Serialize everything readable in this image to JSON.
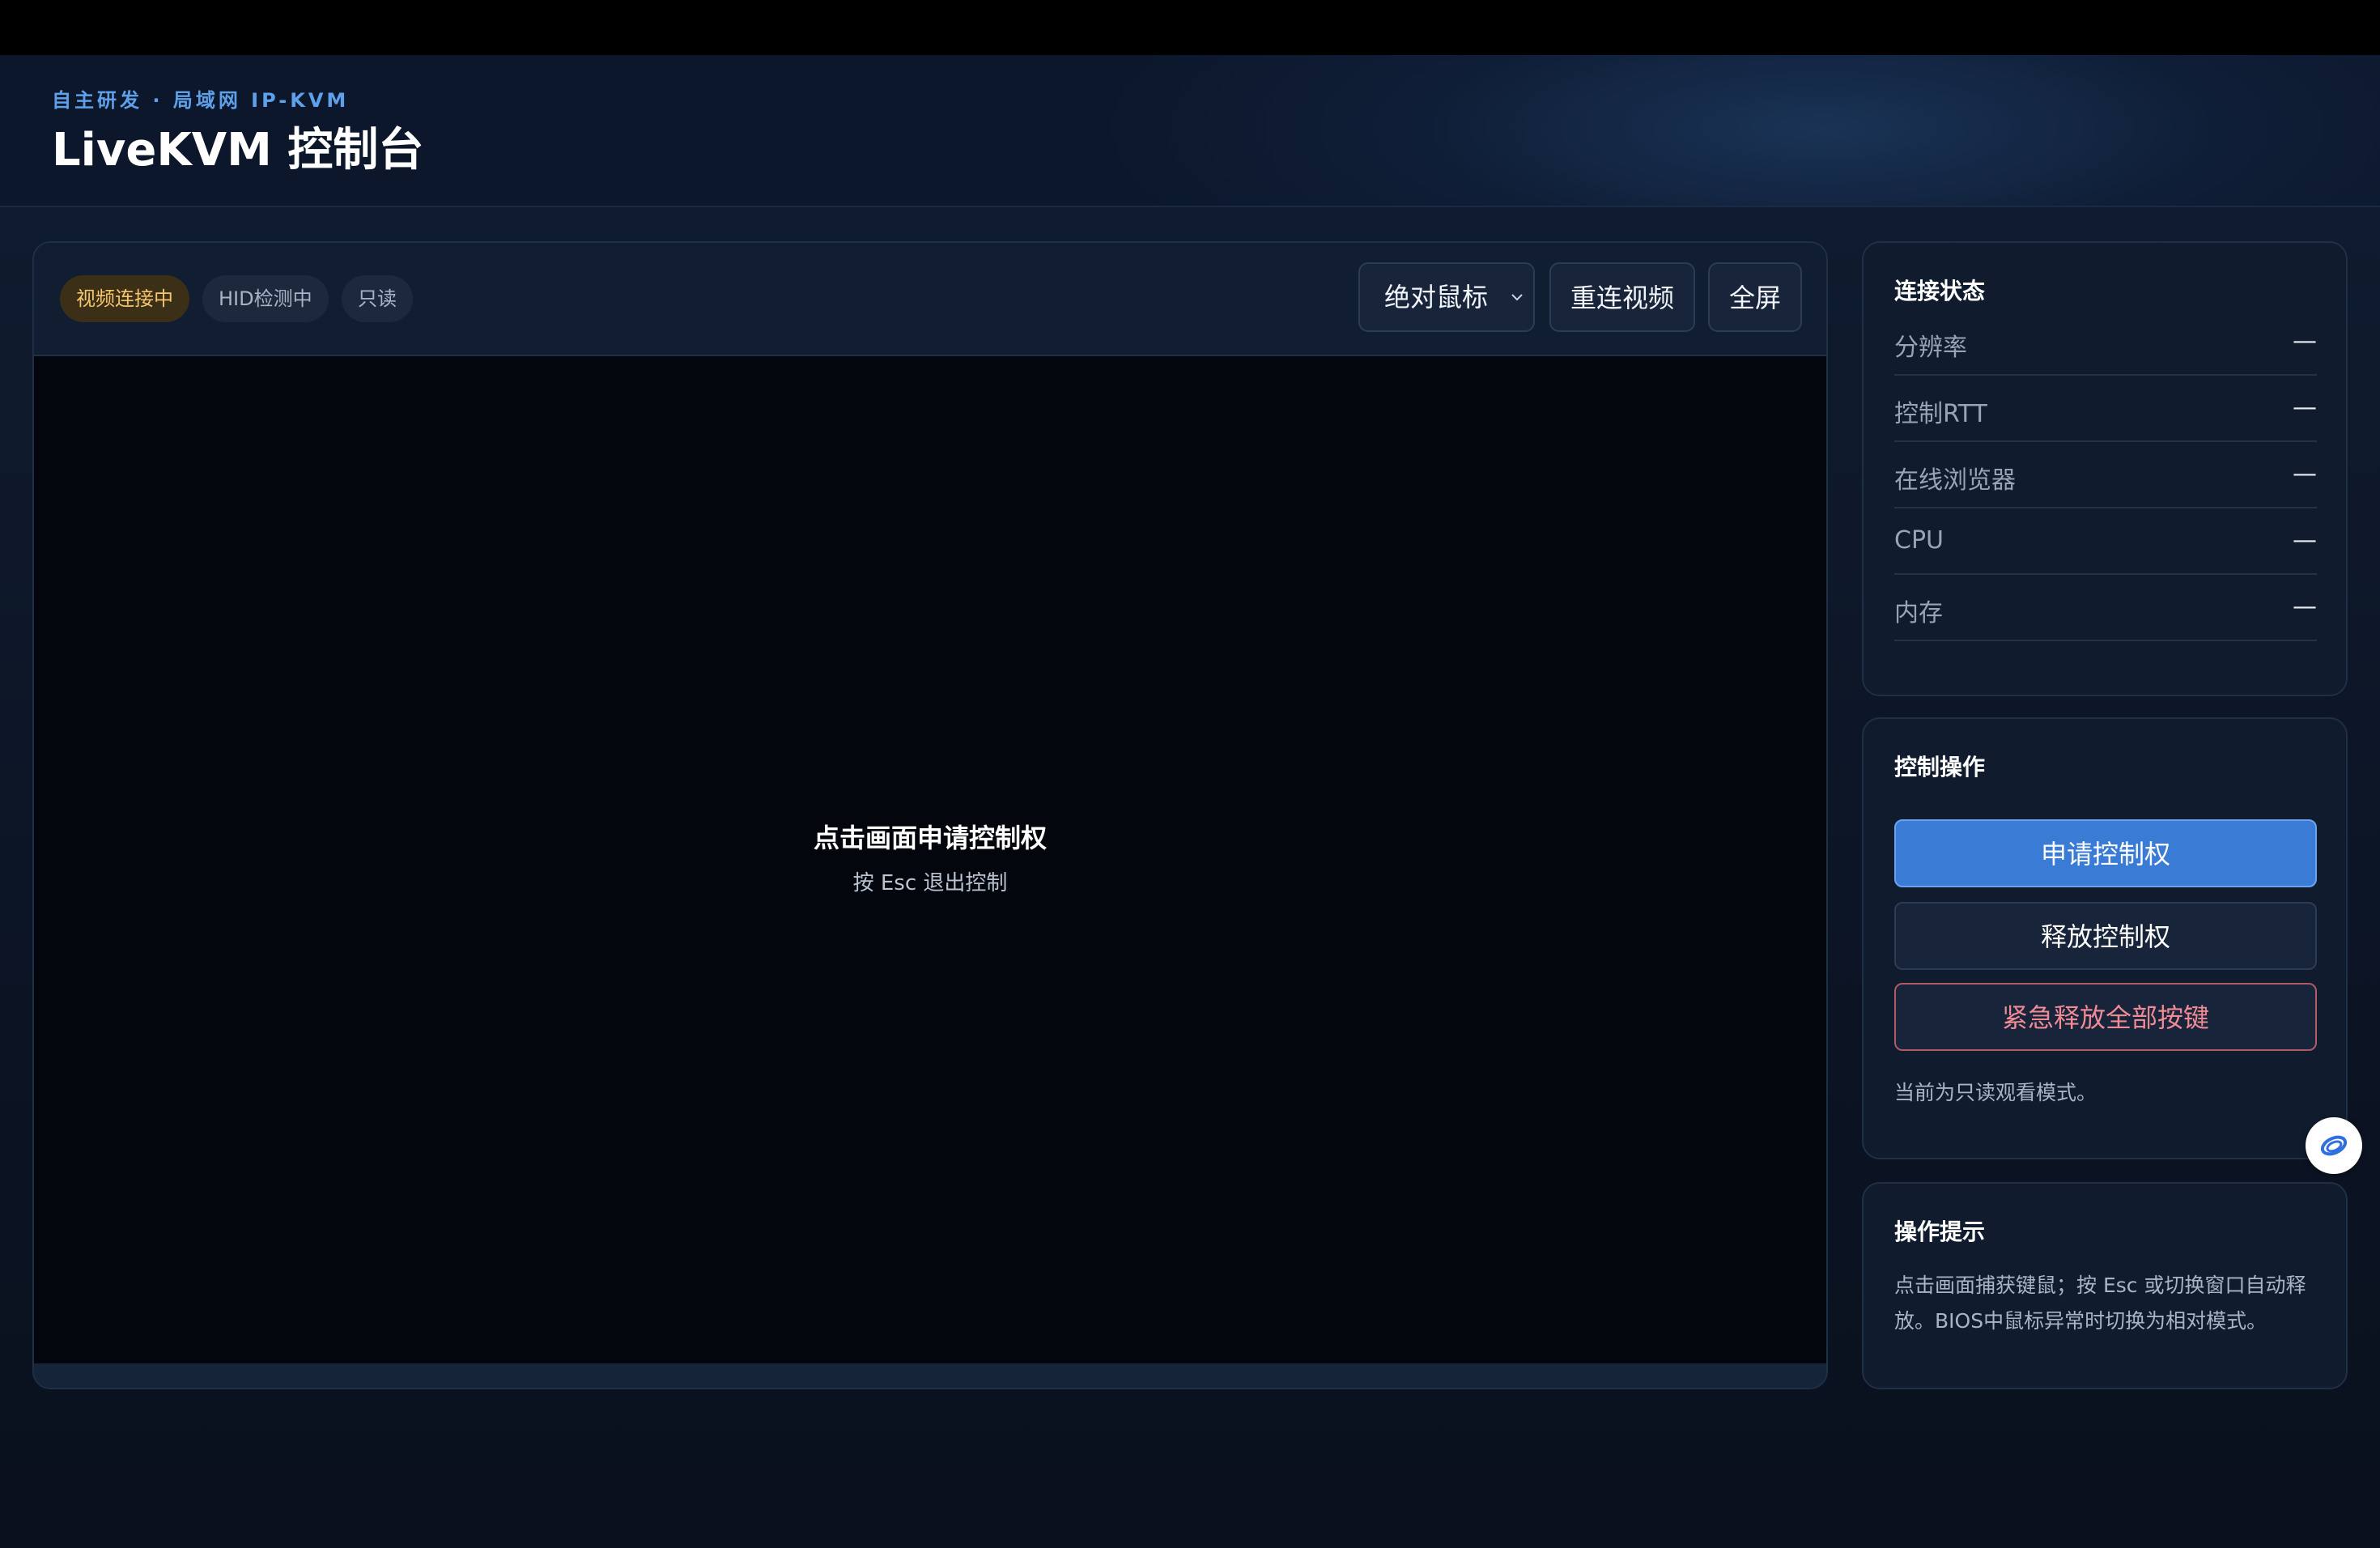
{
  "header": {
    "eyebrow": "自主研发 · 局域网 IP-KVM",
    "title": "LiveKVM 控制台"
  },
  "toolbar": {
    "badges": {
      "video": "视频连接中",
      "hid": "HID检测中",
      "readonly": "只读"
    },
    "mouse_mode": "绝对鼠标",
    "reconnect_label": "重连视频",
    "fullscreen_label": "全屏"
  },
  "screen": {
    "prompt": "点击画面申请控制权",
    "hint": "按 Esc 退出控制"
  },
  "status": {
    "title": "连接状态",
    "rows": [
      {
        "label": "分辨率",
        "value": "—"
      },
      {
        "label": "控制RTT",
        "value": "—"
      },
      {
        "label": "在线浏览器",
        "value": "—"
      },
      {
        "label": "CPU",
        "value": "—"
      },
      {
        "label": "内存",
        "value": "—"
      }
    ]
  },
  "control": {
    "title": "控制操作",
    "request_label": "申请控制权",
    "release_label": "释放控制权",
    "emergency_label": "紧急释放全部按键",
    "mode_note": "当前为只读观看模式。"
  },
  "tips": {
    "title": "操作提示",
    "text": "点击画面捕获键鼠；按 Esc 或切换窗口自动释放。BIOS中鼠标异常时切换为相对模式。"
  },
  "colors": {
    "accent": "#3a7bd5",
    "eyebrow": "#5ea1ea",
    "warning_badge": "#f5c56b",
    "danger": "#f08a94"
  },
  "icons": {
    "floating": "assistant-ring-icon",
    "select": "chevron-down-icon"
  }
}
